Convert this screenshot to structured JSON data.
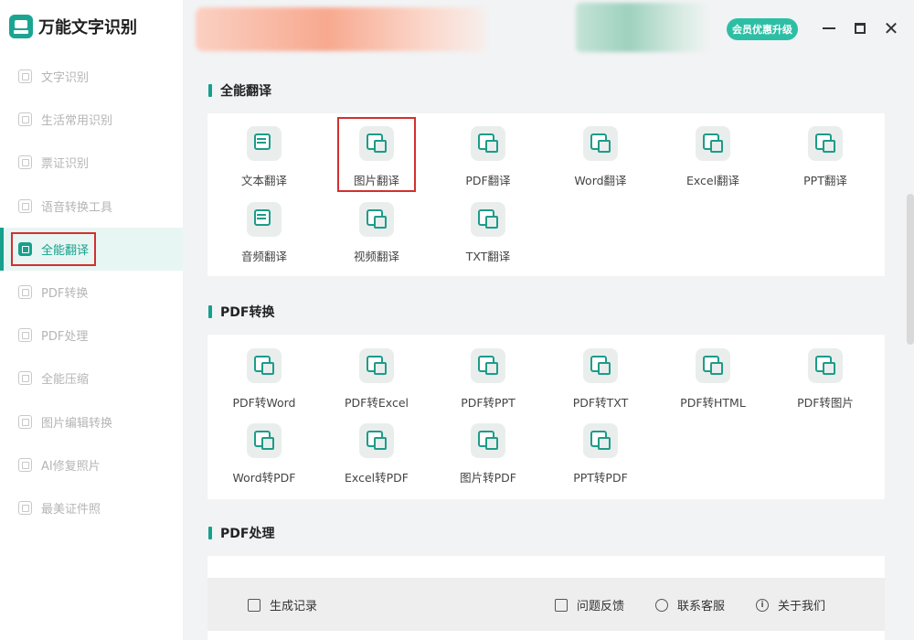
{
  "app": {
    "title": "万能文字识别"
  },
  "header": {
    "vip_label": "会员优惠升级",
    "minimize_icon": "minimize-icon",
    "maximize_icon": "maximize-icon",
    "close_icon": "close-icon"
  },
  "sidebar": {
    "items": [
      {
        "label": "文字识别",
        "icon": "text-scan-icon",
        "active": false
      },
      {
        "label": "生活常用识别",
        "icon": "life-scan-icon",
        "active": false
      },
      {
        "label": "票证识别",
        "icon": "ticket-scan-icon",
        "active": false
      },
      {
        "label": "语音转换工具",
        "icon": "voice-icon",
        "active": false
      },
      {
        "label": "全能翻译",
        "icon": "translate-icon",
        "active": true
      },
      {
        "label": "PDF转换",
        "icon": "pdf-convert-icon",
        "active": false
      },
      {
        "label": "PDF处理",
        "icon": "pdf-process-icon",
        "active": false
      },
      {
        "label": "全能压缩",
        "icon": "compress-icon",
        "active": false
      },
      {
        "label": "图片编辑转换",
        "icon": "image-edit-icon",
        "active": false
      },
      {
        "label": "AI修复照片",
        "icon": "ai-repair-icon",
        "active": false
      },
      {
        "label": "最美证件照",
        "icon": "id-photo-icon",
        "active": false
      }
    ]
  },
  "sections": {
    "translate": {
      "title": "全能翻译",
      "tiles": [
        {
          "label": "文本翻译",
          "icon": "text-translate-icon"
        },
        {
          "label": "图片翻译",
          "icon": "image-translate-icon"
        },
        {
          "label": "PDF翻译",
          "icon": "pdf-translate-icon"
        },
        {
          "label": "Word翻译",
          "icon": "word-translate-icon"
        },
        {
          "label": "Excel翻译",
          "icon": "excel-translate-icon"
        },
        {
          "label": "PPT翻译",
          "icon": "ppt-translate-icon"
        },
        {
          "label": "音频翻译",
          "icon": "audio-translate-icon"
        },
        {
          "label": "视频翻译",
          "icon": "video-translate-icon"
        },
        {
          "label": "TXT翻译",
          "icon": "txt-translate-icon"
        }
      ]
    },
    "pdf_convert": {
      "title": "PDF转换",
      "tiles": [
        {
          "label": "PDF转Word",
          "icon": "pdf-to-word-icon"
        },
        {
          "label": "PDF转Excel",
          "icon": "pdf-to-excel-icon"
        },
        {
          "label": "PDF转PPT",
          "icon": "pdf-to-ppt-icon"
        },
        {
          "label": "PDF转TXT",
          "icon": "pdf-to-txt-icon"
        },
        {
          "label": "PDF转HTML",
          "icon": "pdf-to-html-icon"
        },
        {
          "label": "PDF转图片",
          "icon": "pdf-to-image-icon"
        },
        {
          "label": "Word转PDF",
          "icon": "word-to-pdf-icon"
        },
        {
          "label": "Excel转PDF",
          "icon": "excel-to-pdf-icon"
        },
        {
          "label": "图片转PDF",
          "icon": "image-to-pdf-icon"
        },
        {
          "label": "PPT转PDF",
          "icon": "ppt-to-pdf-icon"
        }
      ]
    },
    "pdf_process": {
      "title": "PDF处理"
    }
  },
  "footer": {
    "history_label": "生成记录",
    "feedback_label": "问题反馈",
    "support_label": "联系客服",
    "about_label": "关于我们"
  },
  "colors": {
    "accent": "#17a08c",
    "highlight": "#d32f2f",
    "vip": "#2dbfa5"
  }
}
